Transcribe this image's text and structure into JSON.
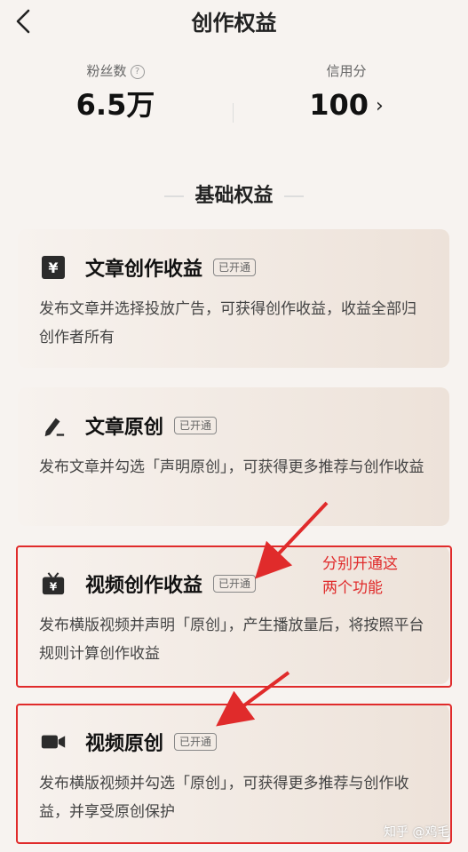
{
  "header": {
    "title": "创作权益"
  },
  "stats": {
    "fans": {
      "label": "粉丝数",
      "value": "6.5万"
    },
    "credit": {
      "label": "信用分",
      "value": "100"
    }
  },
  "section": {
    "title": "基础权益"
  },
  "cards": [
    {
      "title": "文章创作收益",
      "badge": "已开通",
      "desc": "发布文章并选择投放广告，可获得创作收益，收益全部归创作者所有",
      "icon": "yen-icon"
    },
    {
      "title": "文章原创",
      "badge": "已开通",
      "desc": "发布文章并勾选「声明原创」，可获得更多推荐与创作收益",
      "icon": "pen-icon"
    },
    {
      "title": "视频创作收益",
      "badge": "已开通",
      "desc": "发布横版视频并声明「原创」，产生播放量后，将按照平台规则计算创作收益",
      "icon": "tv-yen-icon"
    },
    {
      "title": "视频原创",
      "badge": "已开通",
      "desc": "发布横版视频并勾选「原创」，可获得更多推荐与创作收益，并享受原创保护",
      "icon": "video-camera-icon"
    }
  ],
  "annotation": {
    "line1": "分别开通这",
    "line2": "两个功能",
    "color": "#e02b2b"
  },
  "watermark": "知乎 @鸡毛"
}
